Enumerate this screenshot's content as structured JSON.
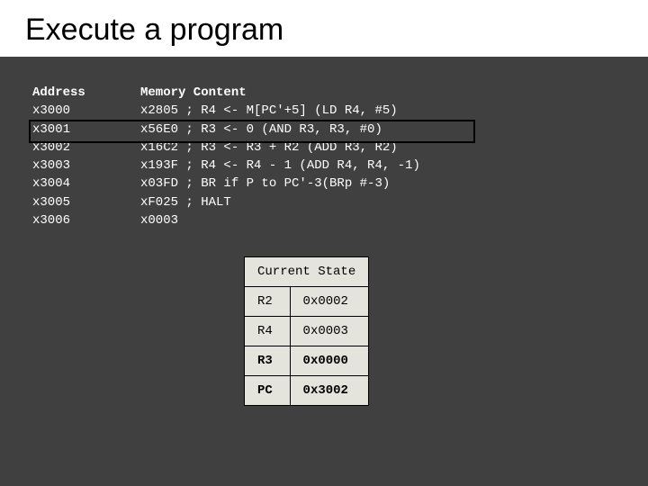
{
  "title": "Execute a program",
  "headers": {
    "addr": "Address",
    "mem": "Memory Content"
  },
  "rows": [
    {
      "addr": "x3000",
      "mem": "x2805 ; R4 <- M[PC'+5] (LD R4, #5)"
    },
    {
      "addr": "x3001",
      "mem": "x56E0 ; R3 <- 0 (AND R3, R3, #0)"
    },
    {
      "addr": "x3002",
      "mem": "x16C2 ; R3 <- R3 + R2 (ADD R3, R2)"
    },
    {
      "addr": "x3003",
      "mem": "x193F ; R4 <- R4 - 1 (ADD R4, R4, -1)"
    },
    {
      "addr": "x3004",
      "mem": "x03FD ; BR if P to PC'-3(BRp #-3)"
    },
    {
      "addr": "x3005",
      "mem": "xF025 ; HALT"
    },
    {
      "addr": "x3006",
      "mem": "x0003"
    }
  ],
  "highlight_index": 1,
  "state": {
    "title": "Current State",
    "rows": [
      {
        "reg": "R2",
        "val": "0x0002",
        "bold": false
      },
      {
        "reg": "R4",
        "val": "0x0003",
        "bold": false
      },
      {
        "reg": "R3",
        "val": "0x0000",
        "bold": true
      },
      {
        "reg": "PC",
        "val": "0x3002",
        "bold": true
      }
    ]
  }
}
